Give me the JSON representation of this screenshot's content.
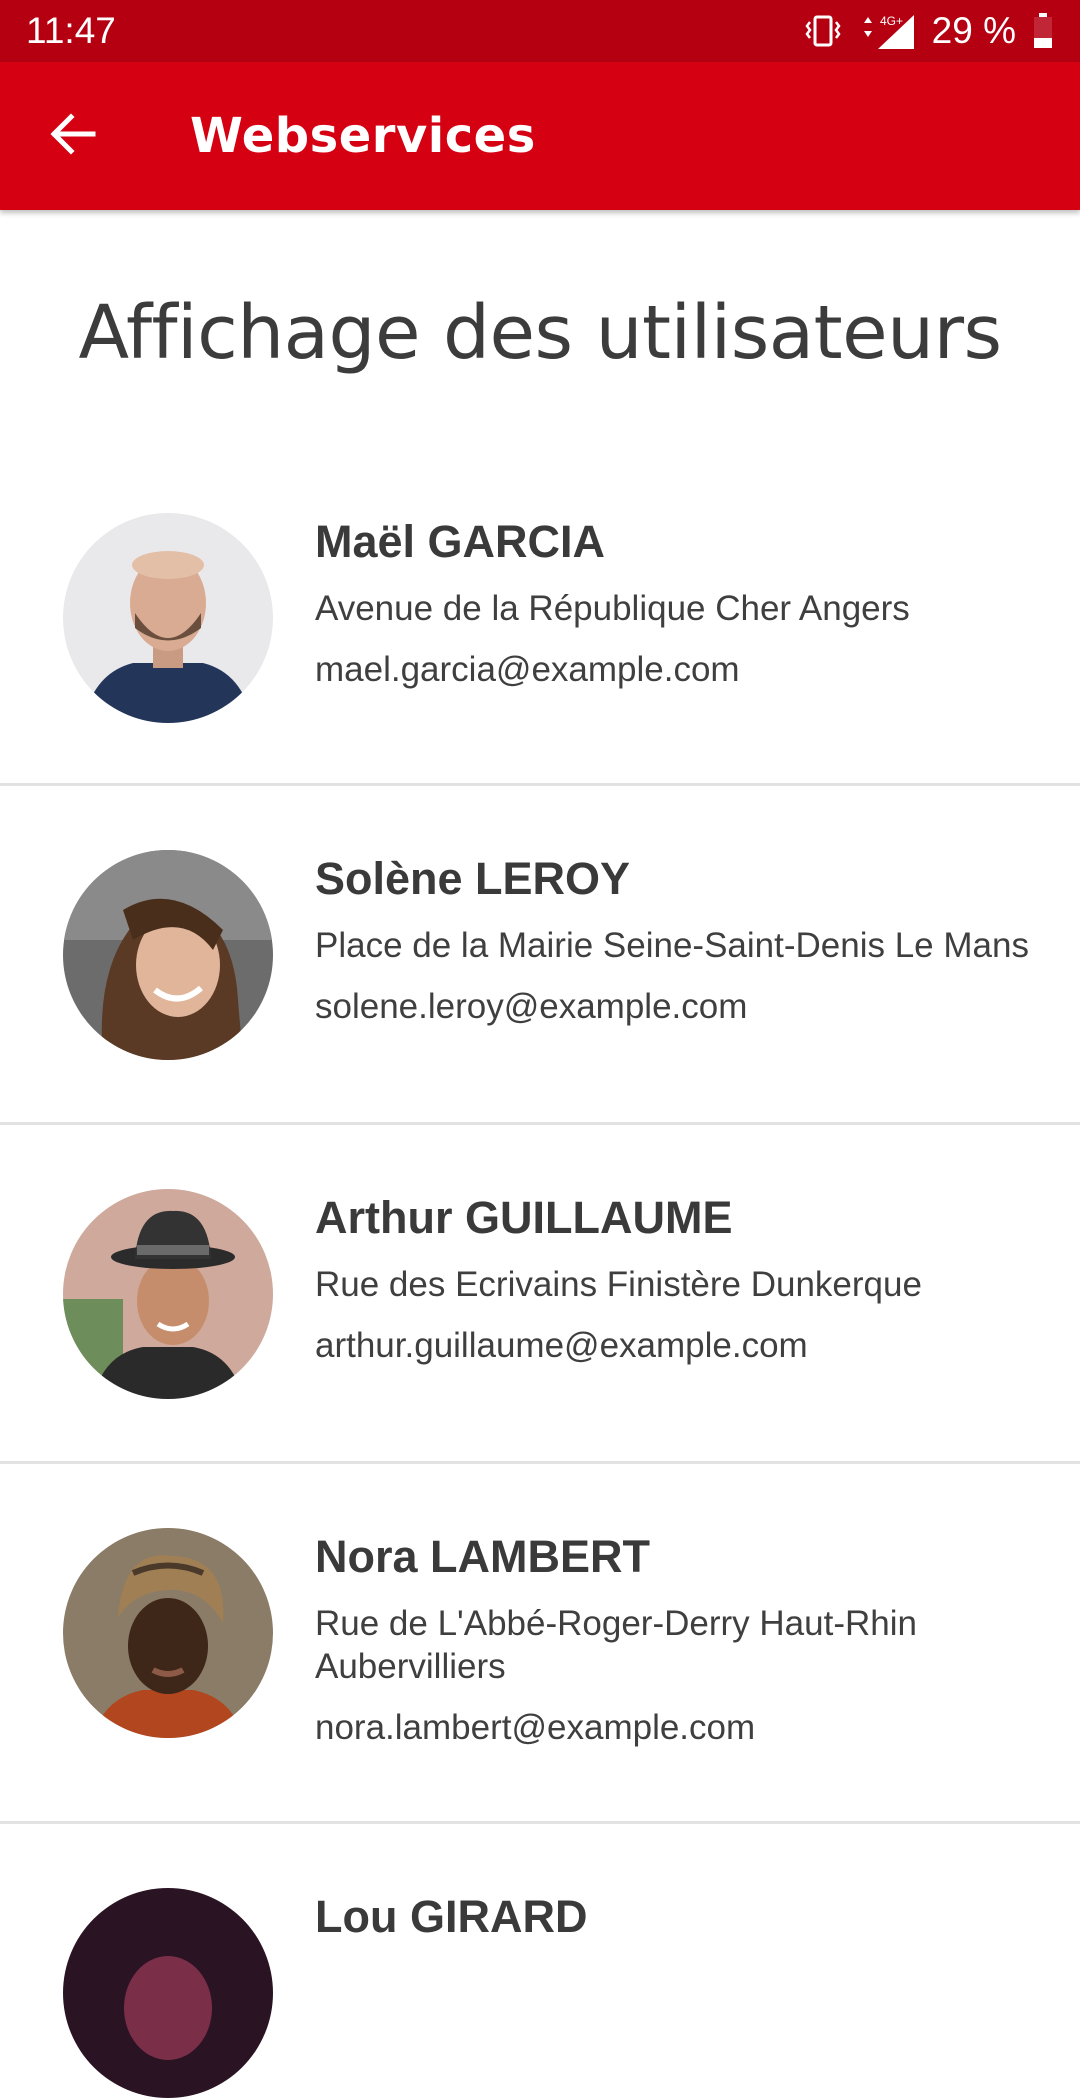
{
  "status_bar": {
    "time": "11:47",
    "network": "4G+",
    "battery": "29 %",
    "icons": [
      "vibrate-icon",
      "data-arrows-icon",
      "signal-icon",
      "battery-icon"
    ]
  },
  "app_bar": {
    "title": "Webservices",
    "back_icon": "arrow-back-icon",
    "color": "#d50012",
    "status_color": "#b50012"
  },
  "page": {
    "title": "Affichage des utilisateurs"
  },
  "users": [
    {
      "name": "Maël GARCIA",
      "address": "Avenue de la République Cher Angers",
      "email": "mael.garcia@example.com",
      "avatar": "avatar-photo"
    },
    {
      "name": "Solène LEROY",
      "address": "Place de la Mairie Seine-Saint-Denis Le Mans",
      "email": "solene.leroy@example.com",
      "avatar": "avatar-photo"
    },
    {
      "name": "Arthur GUILLAUME",
      "address": "Rue des Ecrivains Finistère Dunkerque",
      "email": "arthur.guillaume@example.com",
      "avatar": "avatar-photo"
    },
    {
      "name": "Nora LAMBERT",
      "address": "Rue de L'Abbé-Roger-Derry Haut-Rhin Aubervilliers",
      "email": "nora.lambert@example.com",
      "avatar": "avatar-photo"
    },
    {
      "name": "Lou GIRARD",
      "address": "",
      "email": "",
      "avatar": "avatar-photo"
    }
  ]
}
